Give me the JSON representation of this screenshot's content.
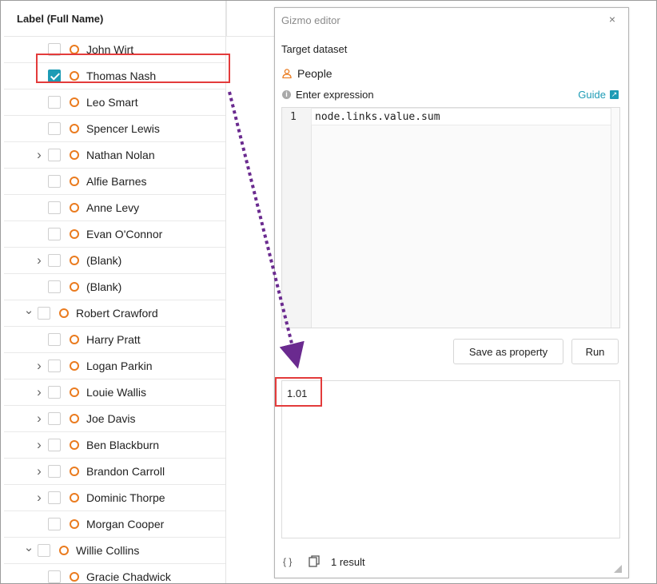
{
  "tree": {
    "header": "Label (Full Name)",
    "rows": [
      {
        "label": "John Wirt",
        "indent": 1,
        "expand": "none",
        "checked": false
      },
      {
        "label": "Thomas Nash",
        "indent": 1,
        "expand": "none",
        "checked": true
      },
      {
        "label": "Leo Smart",
        "indent": 1,
        "expand": "none",
        "checked": false
      },
      {
        "label": "Spencer Lewis",
        "indent": 1,
        "expand": "none",
        "checked": false
      },
      {
        "label": "Nathan Nolan",
        "indent": 1,
        "expand": "collapsed",
        "checked": false
      },
      {
        "label": "Alfie Barnes",
        "indent": 1,
        "expand": "none",
        "checked": false
      },
      {
        "label": "Anne Levy",
        "indent": 1,
        "expand": "none",
        "checked": false
      },
      {
        "label": "Evan O'Connor",
        "indent": 1,
        "expand": "none",
        "checked": false
      },
      {
        "label": "(Blank)",
        "indent": 1,
        "expand": "collapsed",
        "checked": false
      },
      {
        "label": "(Blank)",
        "indent": 1,
        "expand": "none",
        "checked": false
      },
      {
        "label": "Robert Crawford",
        "indent": 0,
        "expand": "expanded",
        "checked": false
      },
      {
        "label": "Harry Pratt",
        "indent": 1,
        "expand": "none",
        "checked": false
      },
      {
        "label": "Logan Parkin",
        "indent": 1,
        "expand": "collapsed",
        "checked": false
      },
      {
        "label": "Louie Wallis",
        "indent": 1,
        "expand": "collapsed",
        "checked": false
      },
      {
        "label": "Joe Davis",
        "indent": 1,
        "expand": "collapsed",
        "checked": false
      },
      {
        "label": "Ben Blackburn",
        "indent": 1,
        "expand": "collapsed",
        "checked": false
      },
      {
        "label": "Brandon Carroll",
        "indent": 1,
        "expand": "collapsed",
        "checked": false
      },
      {
        "label": "Dominic Thorpe",
        "indent": 1,
        "expand": "collapsed",
        "checked": false
      },
      {
        "label": "Morgan Cooper",
        "indent": 1,
        "expand": "none",
        "checked": false
      },
      {
        "label": "Willie Collins",
        "indent": 0,
        "expand": "expanded",
        "checked": false
      },
      {
        "label": "Gracie Chadwick",
        "indent": 1,
        "expand": "none",
        "checked": false
      }
    ]
  },
  "editor": {
    "title": "Gizmo editor",
    "close_icon": "×",
    "target_dataset_label": "Target dataset",
    "dataset_name": "People",
    "expression_label": "Enter expression",
    "info_icon": "i",
    "guide_label": "Guide",
    "guide_icon": "↗",
    "line_number": "1",
    "expression": "node.links.value.sum",
    "save_button": "Save as property",
    "run_button": "Run",
    "result_value": "1.01",
    "braces_icon": "{ }",
    "result_count": "1 result"
  },
  "colors": {
    "accent": "#1c9bb5",
    "node": "#ea7b1f",
    "highlight": "#e33b3b",
    "arrow": "#6a2a8f"
  }
}
